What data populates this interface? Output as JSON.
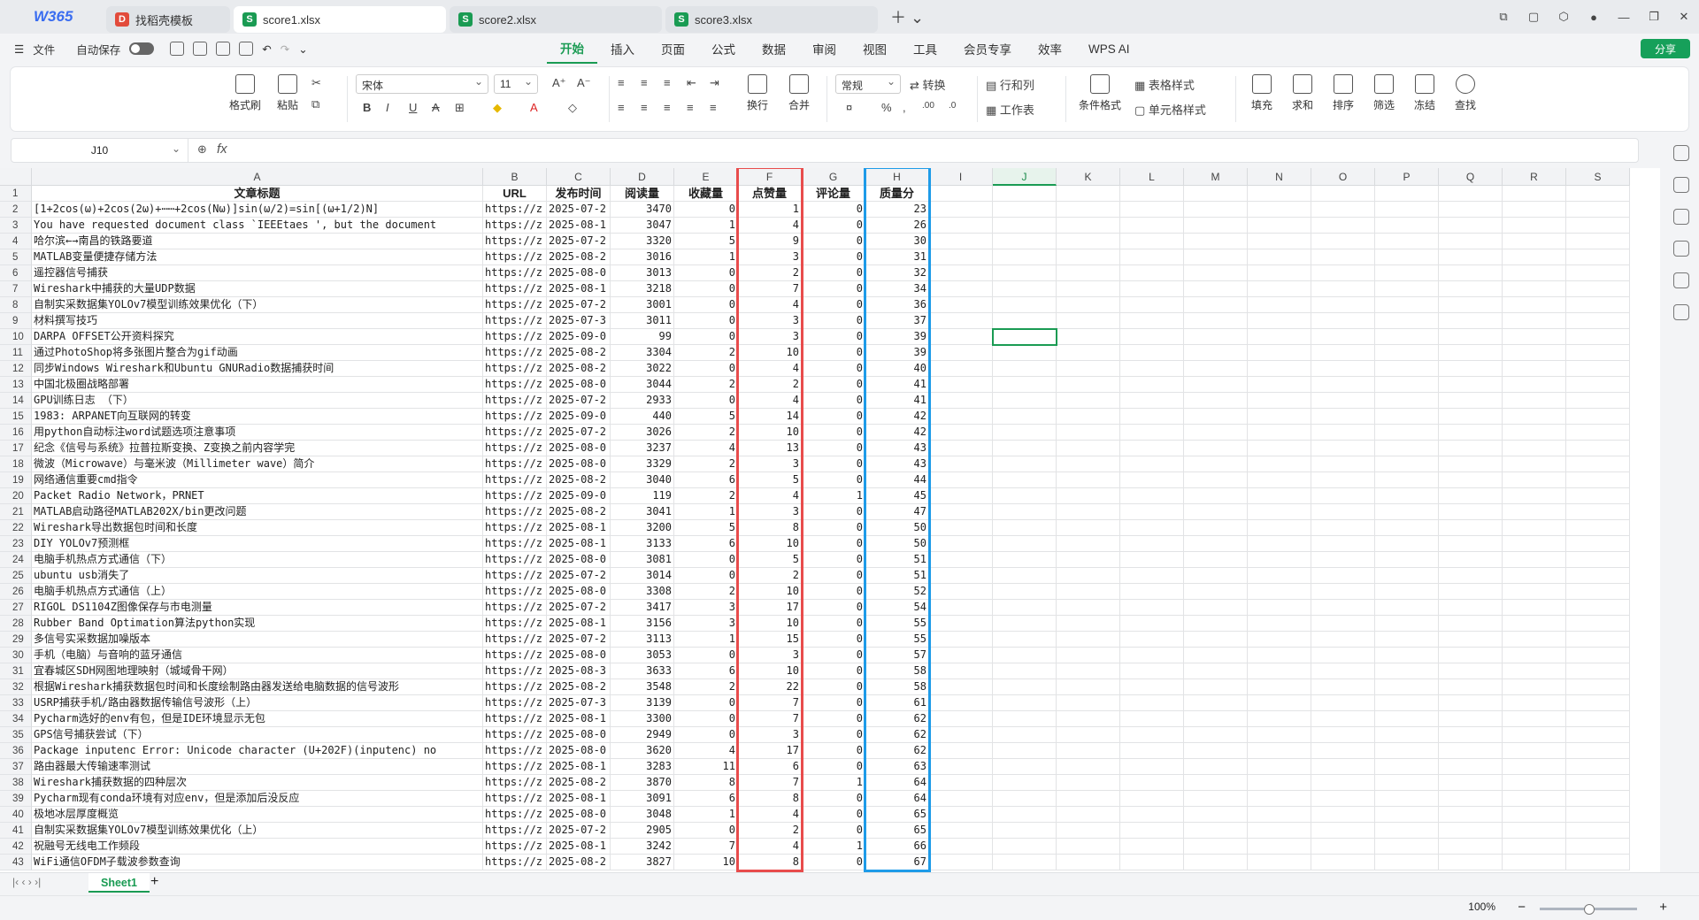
{
  "app": {
    "logo": "W365"
  },
  "tabs": [
    {
      "label": "找稻壳模板",
      "badge": "D",
      "color": "#e24b3b",
      "active": false
    },
    {
      "label": "score1.xlsx",
      "badge": "S",
      "color": "#1a9b53",
      "active": true
    },
    {
      "label": "score2.xlsx",
      "badge": "S",
      "color": "#1a9b53",
      "active": false
    },
    {
      "label": "score3.xlsx",
      "badge": "S",
      "color": "#1a9b53",
      "active": false
    }
  ],
  "menu": {
    "file": "文件",
    "autosave": "自动保存",
    "tabs": [
      "开始",
      "插入",
      "页面",
      "公式",
      "数据",
      "审阅",
      "视图",
      "工具",
      "会员专享",
      "效率",
      "WPS AI"
    ],
    "active_tab": "开始",
    "share": "分享"
  },
  "ribbon": {
    "format_painter": "格式刷",
    "paste": "粘贴",
    "font": "宋体",
    "font_size": "11",
    "number_format": "常规",
    "wrap": "换行",
    "merge": "合并",
    "convert": "转换",
    "rowcol": "行和列",
    "worksheet": "工作表",
    "cond_format": "条件格式",
    "table_style": "表格样式",
    "cell_style": "单元格样式",
    "fill": "填充",
    "sum": "求和",
    "sort": "排序",
    "filter": "筛选",
    "freeze": "冻结",
    "find": "查找"
  },
  "formula_bar": {
    "name_box": "J10",
    "fx": "fx",
    "formula": ""
  },
  "columns": [
    "A",
    "B",
    "C",
    "D",
    "E",
    "F",
    "G",
    "H",
    "I",
    "J",
    "K",
    "L",
    "M",
    "N",
    "O",
    "P",
    "Q",
    "R",
    "S"
  ],
  "headers": [
    "文章标题",
    "URL",
    "发布时间",
    "阅读量",
    "收藏量",
    "点赞量",
    "评论量",
    "质量分"
  ],
  "rows": [
    [
      "[1+2cos(ω)+2cos(2ω)+⋯⋯+2cos(Nω)]sin(ω/2)=sin[(ω+1/2)N]",
      "https://z",
      "2025-07-2",
      "3470",
      "0",
      "1",
      "0",
      "23"
    ],
    [
      "You have requested document class `IEEEtaes ', but the document",
      "https://z",
      "2025-08-1",
      "3047",
      "1",
      "4",
      "0",
      "26"
    ],
    [
      "哈尔滨←→南昌的铁路要道",
      "https://z",
      "2025-07-2",
      "3320",
      "5",
      "9",
      "0",
      "30"
    ],
    [
      "MATLAB变量便捷存储方法",
      "https://z",
      "2025-08-2",
      "3016",
      "1",
      "3",
      "0",
      "31"
    ],
    [
      "遥控器信号捕获",
      "https://z",
      "2025-08-0",
      "3013",
      "0",
      "2",
      "0",
      "32"
    ],
    [
      "Wireshark中捕获的大量UDP数据",
      "https://z",
      "2025-08-1",
      "3218",
      "0",
      "7",
      "0",
      "34"
    ],
    [
      "自制实采数据集YOLOv7模型训练效果优化（下）",
      "https://z",
      "2025-07-2",
      "3001",
      "0",
      "4",
      "0",
      "36"
    ],
    [
      "材料撰写技巧",
      "https://z",
      "2025-07-3",
      "3011",
      "0",
      "3",
      "0",
      "37"
    ],
    [
      "DARPA OFFSET公开资料探究",
      "https://z",
      "2025-09-0",
      "99",
      "0",
      "3",
      "0",
      "39"
    ],
    [
      "通过PhotoShop将多张图片整合为gif动画",
      "https://z",
      "2025-08-2",
      "3304",
      "2",
      "10",
      "0",
      "39"
    ],
    [
      "同步Windows Wireshark和Ubuntu GNURadio数据捕获时间",
      "https://z",
      "2025-08-2",
      "3022",
      "0",
      "4",
      "0",
      "40"
    ],
    [
      "中国北极圈战略部署",
      "https://z",
      "2025-08-0",
      "3044",
      "2",
      "2",
      "0",
      "41"
    ],
    [
      "GPU训练日志 （下）",
      "https://z",
      "2025-07-2",
      "2933",
      "0",
      "4",
      "0",
      "41"
    ],
    [
      "1983: ARPANET向互联网的转变",
      "https://z",
      "2025-09-0",
      "440",
      "5",
      "14",
      "0",
      "42"
    ],
    [
      "用python自动标注word试题选项注意事项",
      "https://z",
      "2025-07-2",
      "3026",
      "2",
      "10",
      "0",
      "42"
    ],
    [
      "纪念《信号与系统》拉普拉斯变换、Z变换之前内容学完",
      "https://z",
      "2025-08-0",
      "3237",
      "4",
      "13",
      "0",
      "43"
    ],
    [
      "微波（Microwave）与毫米波（Millimeter wave）简介",
      "https://z",
      "2025-08-0",
      "3329",
      "2",
      "3",
      "0",
      "43"
    ],
    [
      "网络通信重要cmd指令",
      "https://z",
      "2025-08-2",
      "3040",
      "6",
      "5",
      "0",
      "44"
    ],
    [
      "Packet Radio Network，PRNET",
      "https://z",
      "2025-09-0",
      "119",
      "2",
      "4",
      "1",
      "45"
    ],
    [
      "MATLAB启动路径MATLAB202X/bin更改问题",
      "https://z",
      "2025-08-2",
      "3041",
      "1",
      "3",
      "0",
      "47"
    ],
    [
      "Wireshark导出数据包时间和长度",
      "https://z",
      "2025-08-1",
      "3200",
      "5",
      "8",
      "0",
      "50"
    ],
    [
      "DIY YOLOv7预测框",
      "https://z",
      "2025-08-1",
      "3133",
      "6",
      "10",
      "0",
      "50"
    ],
    [
      "电脑手机热点方式通信（下）",
      "https://z",
      "2025-08-0",
      "3081",
      "0",
      "5",
      "0",
      "51"
    ],
    [
      "ubuntu usb消失了",
      "https://z",
      "2025-07-2",
      "3014",
      "0",
      "2",
      "0",
      "51"
    ],
    [
      "电脑手机热点方式通信（上）",
      "https://z",
      "2025-08-0",
      "3308",
      "2",
      "10",
      "0",
      "52"
    ],
    [
      "RIGOL DS1104Z图像保存与市电测量",
      "https://z",
      "2025-07-2",
      "3417",
      "3",
      "17",
      "0",
      "54"
    ],
    [
      "Rubber Band Optimation算法python实现",
      "https://z",
      "2025-08-1",
      "3156",
      "3",
      "10",
      "0",
      "55"
    ],
    [
      "多信号实采数据加噪版本",
      "https://z",
      "2025-07-2",
      "3113",
      "1",
      "15",
      "0",
      "55"
    ],
    [
      "手机（电脑）与音响的蓝牙通信",
      "https://z",
      "2025-08-0",
      "3053",
      "0",
      "3",
      "0",
      "57"
    ],
    [
      "宜春城区SDH网图地理映射（城域骨干网）",
      "https://z",
      "2025-08-3",
      "3633",
      "6",
      "10",
      "0",
      "58"
    ],
    [
      "根据Wireshark捕获数据包时间和长度绘制路由器发送给电脑数据的信号波形",
      "https://z",
      "2025-08-2",
      "3548",
      "2",
      "22",
      "0",
      "58"
    ],
    [
      "USRP捕获手机/路由器数据传输信号波形（上）",
      "https://z",
      "2025-07-3",
      "3139",
      "0",
      "7",
      "0",
      "61"
    ],
    [
      "Pycharm选好的env有包，但是IDE环境显示无包",
      "https://z",
      "2025-08-1",
      "3300",
      "0",
      "7",
      "0",
      "62"
    ],
    [
      "GPS信号捕获尝试（下）",
      "https://z",
      "2025-08-0",
      "2949",
      "0",
      "3",
      "0",
      "62"
    ],
    [
      "Package inputenc Error: Unicode character (U+202F)(inputenc) no",
      "https://z",
      "2025-08-0",
      "3620",
      "4",
      "17",
      "0",
      "62"
    ],
    [
      "路由器最大传输速率测试",
      "https://z",
      "2025-08-1",
      "3283",
      "11",
      "6",
      "0",
      "63"
    ],
    [
      "Wireshark捕获数据的四种层次",
      "https://z",
      "2025-08-2",
      "3870",
      "8",
      "7",
      "1",
      "64"
    ],
    [
      "Pycharm现有conda环境有对应env，但是添加后没反应",
      "https://z",
      "2025-08-1",
      "3091",
      "6",
      "8",
      "0",
      "64"
    ],
    [
      "极地冰层厚度概览",
      "https://z",
      "2025-08-0",
      "3048",
      "1",
      "4",
      "0",
      "65"
    ],
    [
      "自制实采数据集YOLOv7模型训练效果优化（上）",
      "https://z",
      "2025-07-2",
      "2905",
      "0",
      "2",
      "0",
      "65"
    ],
    [
      "祝融号无线电工作频段",
      "https://z",
      "2025-08-1",
      "3242",
      "7",
      "4",
      "1",
      "66"
    ],
    [
      "WiFi通信OFDM子载波参数查询",
      "https://z",
      "2025-08-2",
      "3827",
      "10",
      "8",
      "0",
      "67"
    ]
  ],
  "sheet": {
    "name": "Sheet1"
  },
  "status": {
    "zoom": "100%"
  },
  "colors": {
    "accent": "#1a9b53",
    "highlight_f": "#e84c4c",
    "highlight_h": "#1e9be8"
  }
}
